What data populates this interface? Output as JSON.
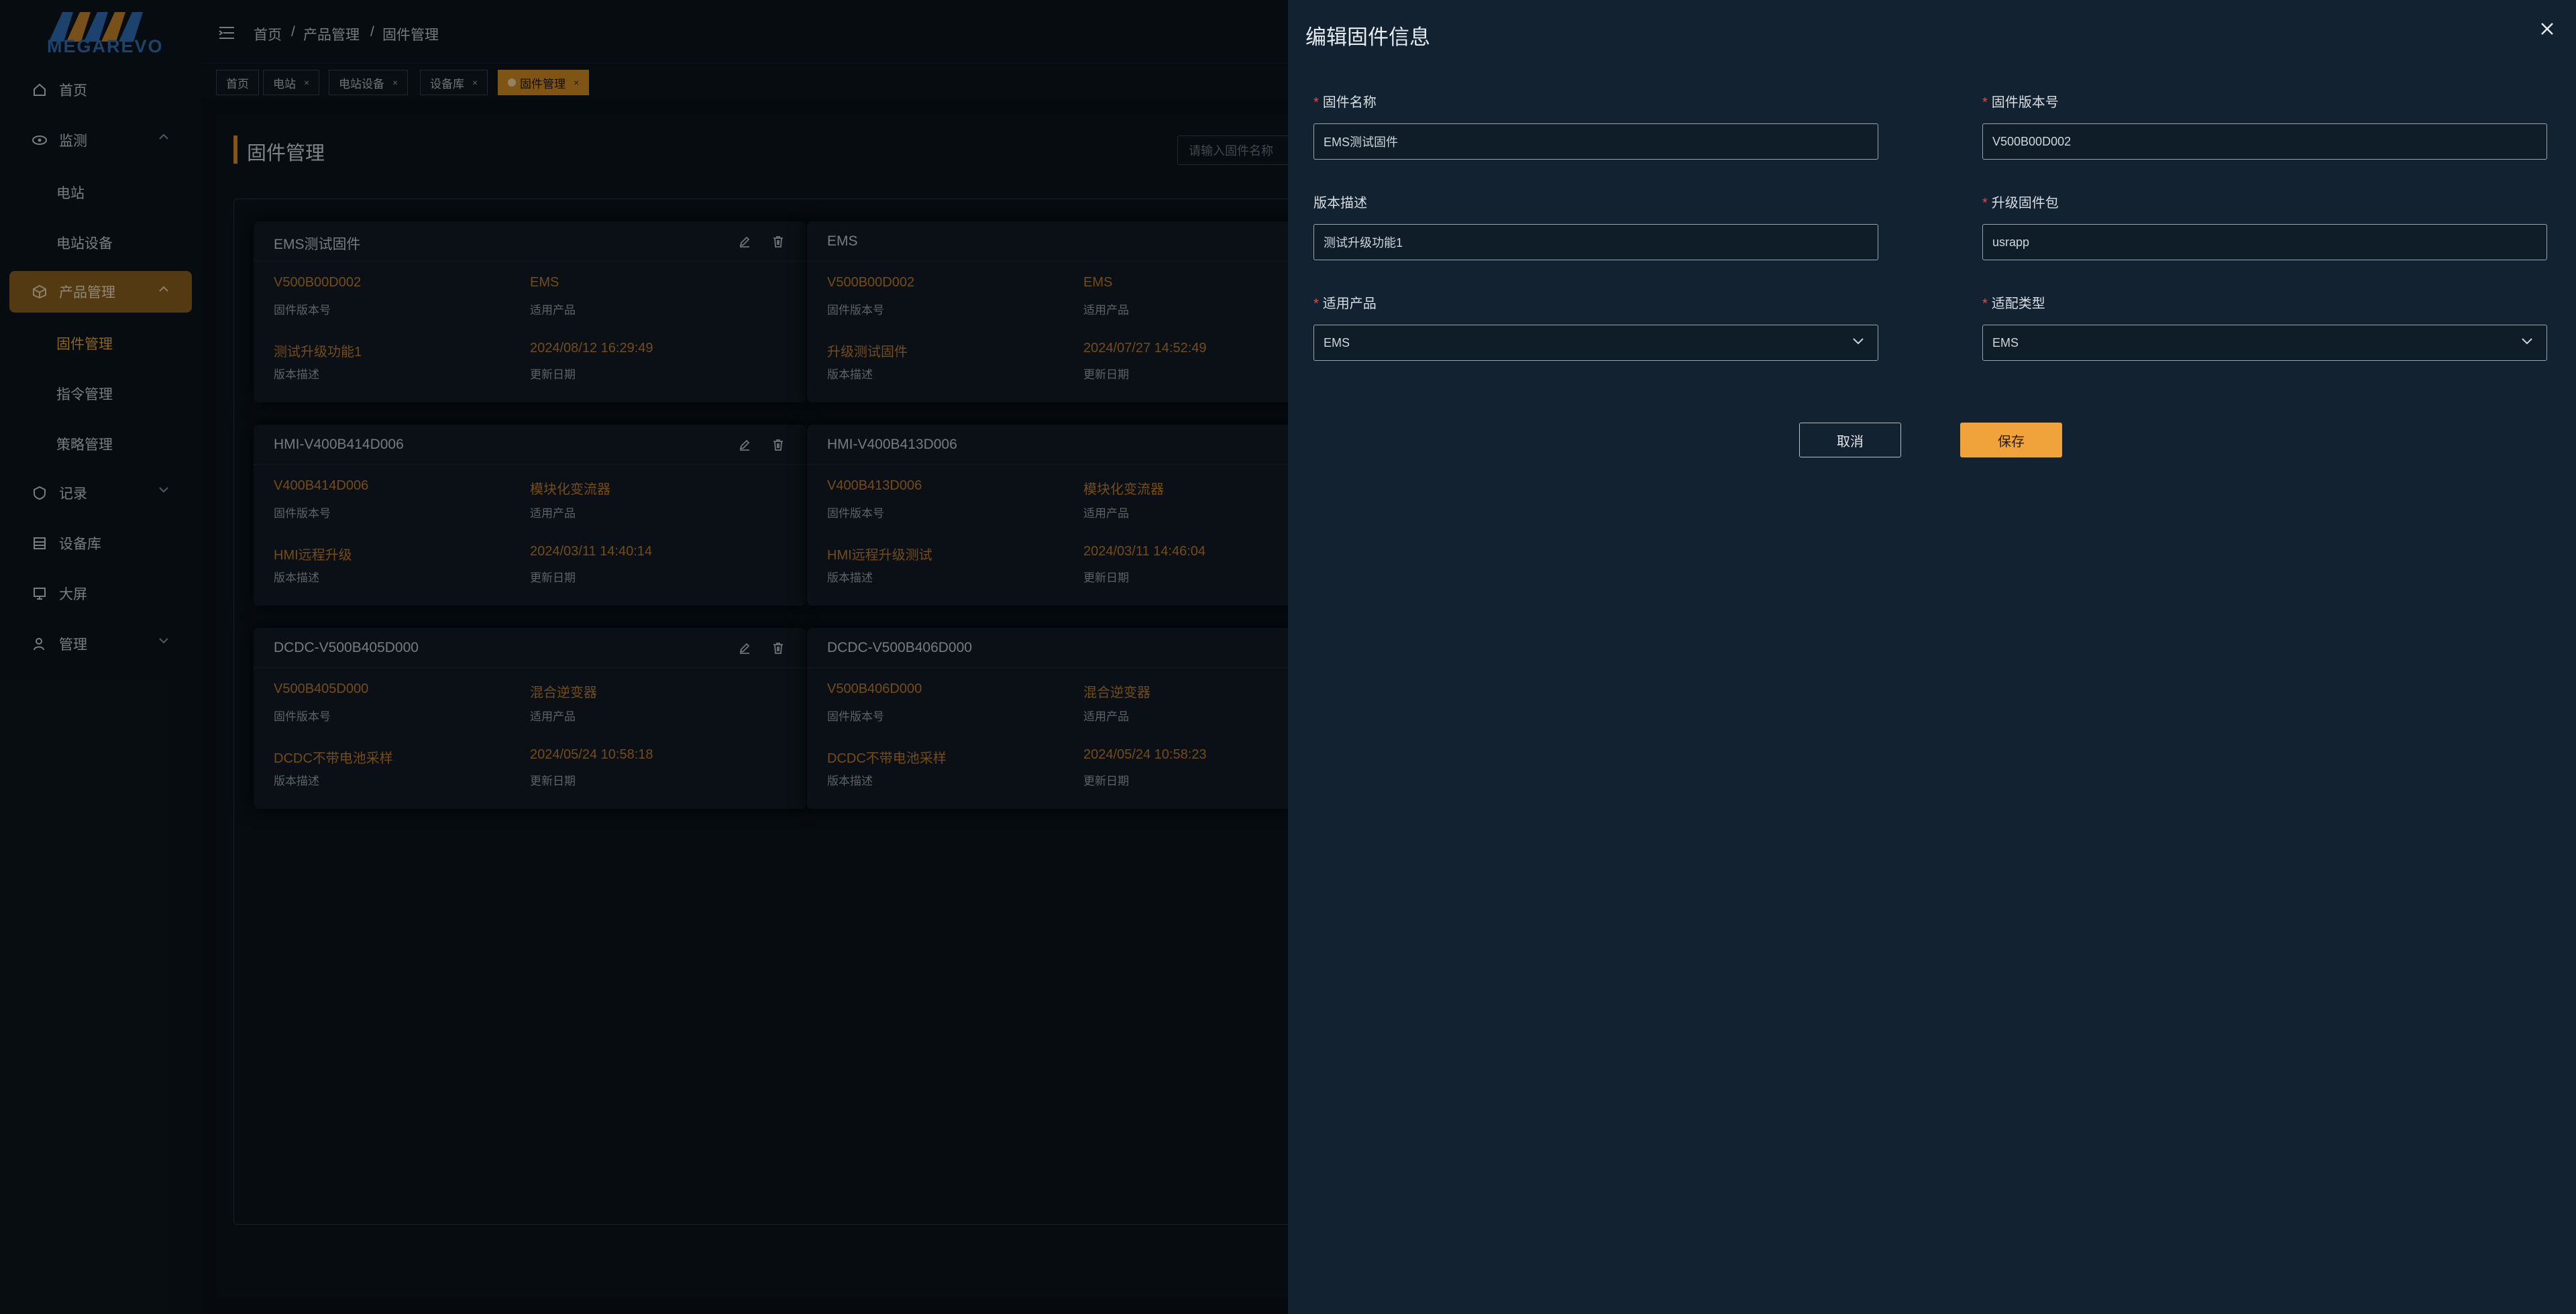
{
  "app": {
    "logo_text": "MEGAREVO"
  },
  "header": {
    "breadcrumb": [
      "首页",
      "产品管理",
      "固件管理"
    ],
    "separator": "/"
  },
  "sidebar": {
    "items": [
      {
        "label": "首页",
        "icon": "home-icon"
      },
      {
        "label": "监测",
        "icon": "eye-icon"
      },
      {
        "label": "电站"
      },
      {
        "label": "电站设备"
      },
      {
        "label": "产品管理",
        "icon": "cube-icon"
      },
      {
        "label": "固件管理"
      },
      {
        "label": "指令管理"
      },
      {
        "label": "策略管理"
      },
      {
        "label": "记录",
        "icon": "record-icon"
      },
      {
        "label": "设备库",
        "icon": "database-icon"
      },
      {
        "label": "大屏",
        "icon": "screen-icon"
      },
      {
        "label": "管理",
        "icon": "user-icon"
      }
    ]
  },
  "tabs": [
    {
      "label": "首页"
    },
    {
      "label": "电站"
    },
    {
      "label": "电站设备"
    },
    {
      "label": "设备库"
    },
    {
      "label": "固件管理"
    }
  ],
  "page": {
    "title": "固件管理",
    "search_placeholder": "请输入固件名称"
  },
  "cards": [
    {
      "title": "EMS测试固件",
      "version": "V500B00D002",
      "version_label": "固件版本号",
      "product": "EMS",
      "product_label": "适用产品",
      "desc": "测试升级功能1",
      "desc_label": "版本描述",
      "date": "2024/08/12 16:29:49",
      "date_label": "更新日期"
    },
    {
      "title": "EMS",
      "version": "V500B00D002",
      "version_label": "固件版本号",
      "product": "EMS",
      "product_label": "适用产品",
      "desc": "升级测试固件",
      "desc_label": "版本描述",
      "date": "2024/07/27 14:52:49",
      "date_label": "更新日期"
    },
    {
      "title": "HMI-V400B414D006",
      "version": "V400B414D006",
      "version_label": "固件版本号",
      "product": "模块化变流器",
      "product_label": "适用产品",
      "desc": "HMI远程升级",
      "desc_label": "版本描述",
      "date": "2024/03/11 14:40:14",
      "date_label": "更新日期"
    },
    {
      "title": "HMI-V400B413D006",
      "version": "V400B413D006",
      "version_label": "固件版本号",
      "product": "模块化变流器",
      "product_label": "适用产品",
      "desc": "HMI远程升级测试",
      "desc_label": "版本描述",
      "date": "2024/03/11 14:46:04",
      "date_label": "更新日期"
    },
    {
      "title": "DCDC-V500B405D000",
      "version": "V500B405D000",
      "version_label": "固件版本号",
      "product": "混合逆变器",
      "product_label": "适用产品",
      "desc": "DCDC不带电池采样",
      "desc_label": "版本描述",
      "date": "2024/05/24 10:58:18",
      "date_label": "更新日期"
    },
    {
      "title": "DCDC-V500B406D000",
      "version": "V500B406D000",
      "version_label": "固件版本号",
      "product": "混合逆变器",
      "product_label": "适用产品",
      "desc": "DCDC不带电池采样",
      "desc_label": "版本描述",
      "date": "2024/05/24 10:58:23",
      "date_label": "更新日期"
    }
  ],
  "drawer": {
    "title": "编辑固件信息",
    "required_mark": "*",
    "fields": {
      "name": {
        "label": "固件名称",
        "value": "EMS测试固件"
      },
      "version": {
        "label": "固件版本号",
        "value": "V500B00D002"
      },
      "desc": {
        "label": "版本描述",
        "value": "测试升级功能1"
      },
      "package": {
        "label": "升级固件包",
        "value": "usrapp"
      },
      "product": {
        "label": "适用产品",
        "value": "EMS"
      },
      "type": {
        "label": "适配类型",
        "value": "EMS"
      }
    },
    "cancel_label": "取消",
    "save_label": "保存"
  },
  "colors": {
    "accent": "#f0a33a",
    "active_nav": "#8b6120",
    "value_text": "#c27f2a",
    "drawer_bg": "#132230"
  }
}
